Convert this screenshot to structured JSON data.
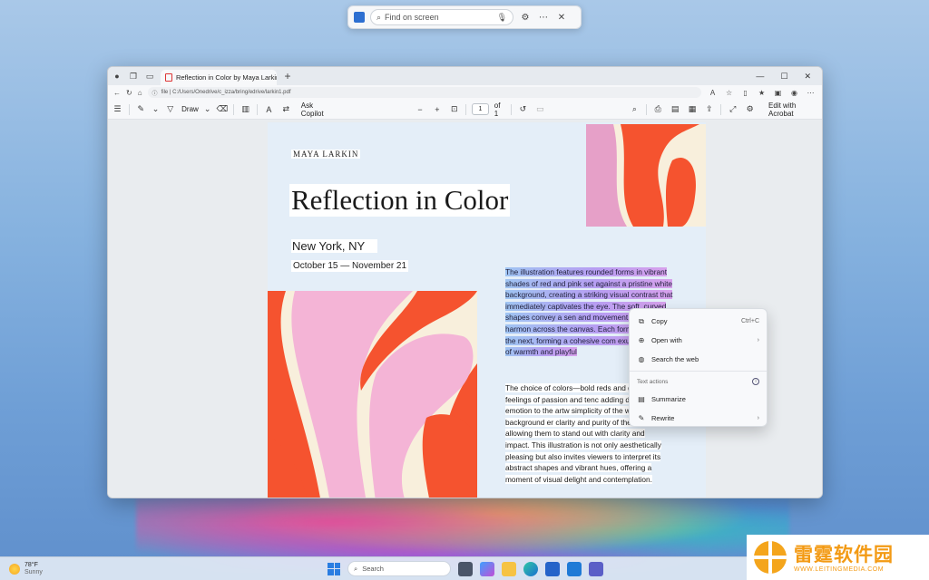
{
  "find_bar": {
    "placeholder": "Find on screen"
  },
  "browser": {
    "tab_title": "Reflection in Color by Maya Larkin",
    "url": "file | C:/Users/Onedrive/c_izza/bring/edrive/larkin1.pdf"
  },
  "pdf_toolbar": {
    "draw_label": "Draw",
    "ask_copilot_label": "Ask Copilot",
    "page_number": "1",
    "page_of": "of 1",
    "edit_label": "Edit with Acrobat"
  },
  "document": {
    "author": "MAYA LARKIN",
    "title": "Reflection in Color",
    "city": "New York, NY",
    "dates": "October 15 — November 21",
    "selected_paragraph": "The illustration features rounded forms in vibrant shades of red and pink set against a pristine white background, creating a striking visual contrast that immediately captivates the eye. The soft, curved shapes convey a sen and movement, suggesting a harmon across the canvas. Each form blends into the next, forming a cohesive com exudes a sense of warmth and playful",
    "body_paragraph": "The choice of colors—bold reds and g —evokes feelings of passion and tenc adding depth and emotion to the artw simplicity of the white background er clarity and purity of the forms, allowing them to stand out with clarity and impact. This illustration is not only aesthetically pleasing but also invites viewers to interpret its abstract shapes and vibrant hues, offering a moment of visual delight and contemplation."
  },
  "context_menu": {
    "copy": "Copy",
    "copy_shortcut": "Ctrl+C",
    "open_with": "Open with",
    "search_web": "Search the web",
    "section_label": "Text actions",
    "summarize": "Summarize",
    "rewrite": "Rewrite"
  },
  "taskbar": {
    "temperature": "78°F",
    "condition": "Sunny",
    "search_label": "Search"
  },
  "watermark": {
    "name": "雷霆软件园",
    "url": "WWW.LEITINGMEDIA.COM"
  },
  "colors": {
    "selection_start": "#9fc4f2",
    "selection_end": "#d7a1ec",
    "art_red": "#f5532f",
    "art_pink": "#f4b4d6",
    "art_cream": "#f8efdc"
  }
}
